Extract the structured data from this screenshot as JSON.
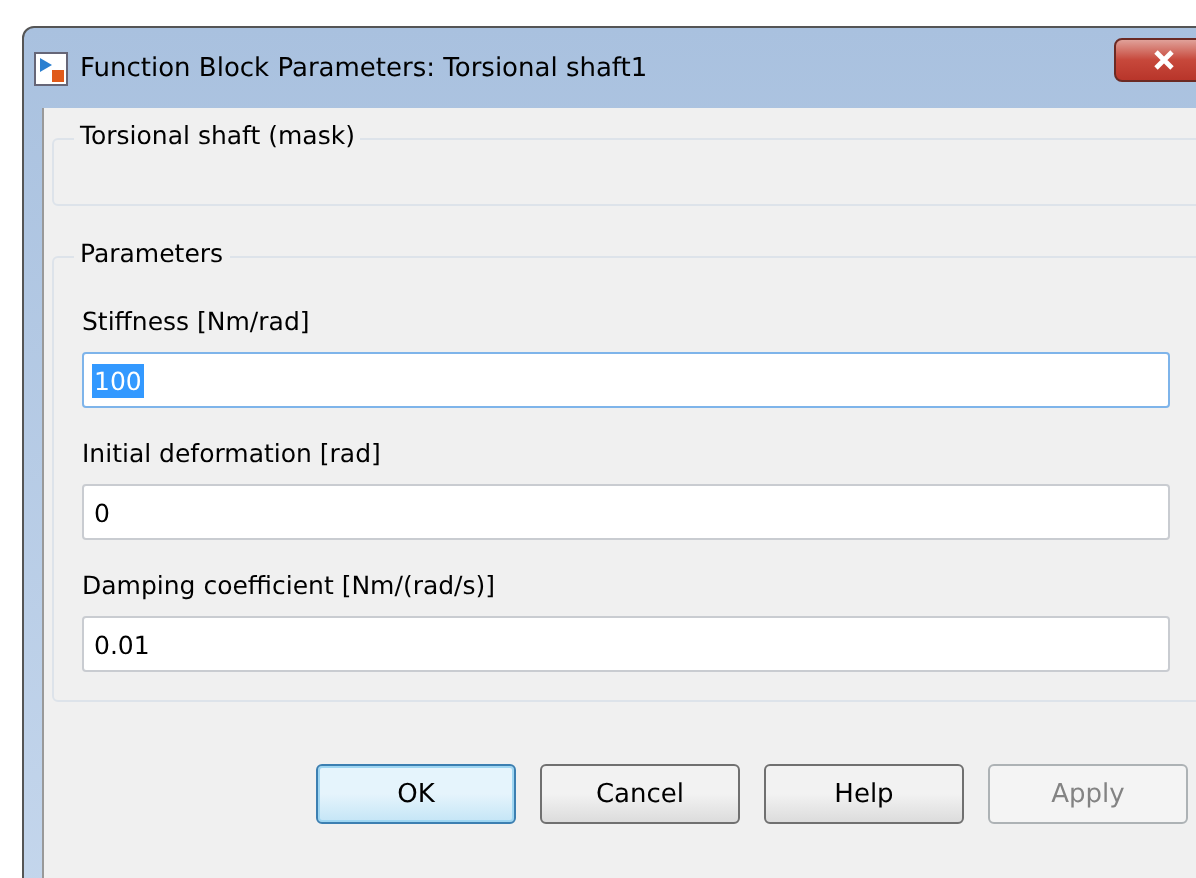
{
  "window": {
    "title": "Function Block Parameters: Torsional shaft1"
  },
  "mask_group": {
    "title": "Torsional shaft (mask)"
  },
  "parameters": {
    "title": "Parameters",
    "fields": [
      {
        "label": "Stiffness [Nm/rad]",
        "value": "100",
        "highlighted": true
      },
      {
        "label": "Initial deformation [rad]",
        "value": "0",
        "highlighted": false
      },
      {
        "label": "Damping coefficient [Nm/(rad/s)]",
        "value": "0.01",
        "highlighted": false
      }
    ]
  },
  "buttons": [
    {
      "label": "OK",
      "default": true,
      "disabled": false
    },
    {
      "label": "Cancel",
      "default": false,
      "disabled": false
    },
    {
      "label": "Help",
      "default": false,
      "disabled": false
    },
    {
      "label": "Apply",
      "default": false,
      "disabled": true
    }
  ]
}
